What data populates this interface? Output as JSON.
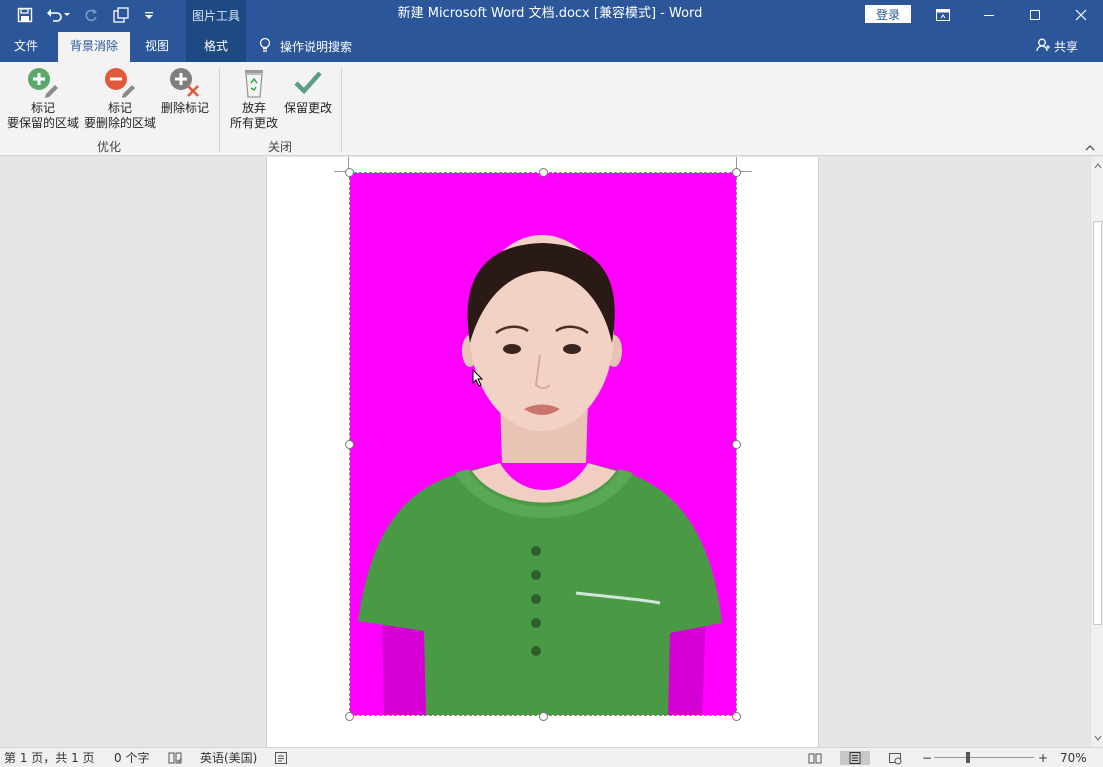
{
  "titlebar": {
    "window_title": "新建 Microsoft Word 文档.docx [兼容模式]  -  Word",
    "context_header": "图片工具",
    "login_label": "登录",
    "qat_icons": [
      "save-icon",
      "undo-icon",
      "redo-icon",
      "touch-mode-icon",
      "customize-qat-icon"
    ],
    "window_icons": [
      "ribbon-display-options-icon",
      "minimize-icon",
      "maximize-icon",
      "close-icon"
    ]
  },
  "tabs": {
    "file": "文件",
    "background_removal": "背景消除",
    "view": "视图",
    "format": "格式",
    "tell_me": "操作说明搜索",
    "share": "共享",
    "active": "背景消除"
  },
  "ribbon": {
    "mark_keep": {
      "line1": "标记",
      "line2": "要保留的区域",
      "icon": "plus-pencil-icon"
    },
    "mark_remove": {
      "line1": "标记",
      "line2": "要删除的区域",
      "icon": "minus-pencil-icon"
    },
    "delete_mark": {
      "line1": "删除标记",
      "icon": "delete-mark-icon"
    },
    "discard_all": {
      "line1": "放弃",
      "line2": "所有更改",
      "icon": "recycle-bin-icon"
    },
    "keep_changes": {
      "line1": "保留更改",
      "icon": "checkmark-icon"
    },
    "group_refine": "优化",
    "group_close": "关闭"
  },
  "colors": {
    "accent": "#2b579a",
    "context_tab": "#1e4a83",
    "removal_overlay": "#ff00ff",
    "shirt": "#4a9a45"
  },
  "statusbar": {
    "page_info": "第 1 页，共 1 页",
    "word_count": "0 个字",
    "language": "英语(美国)",
    "zoom": "70%"
  }
}
